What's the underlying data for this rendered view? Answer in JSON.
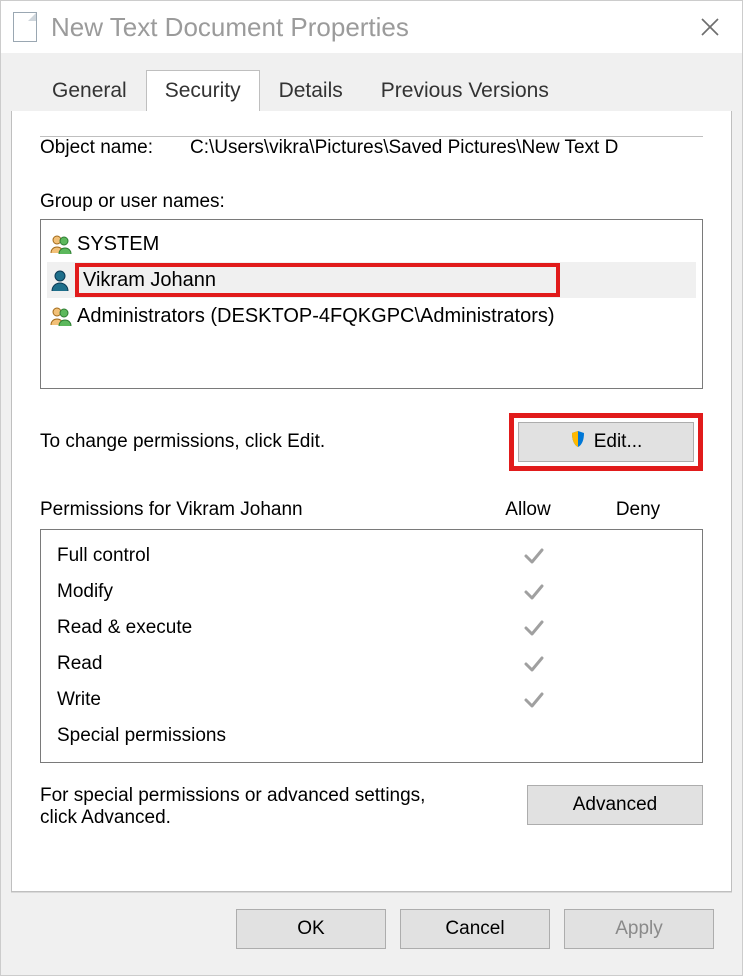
{
  "title": "New Text Document Properties",
  "tabs": [
    "General",
    "Security",
    "Details",
    "Previous Versions"
  ],
  "active_tab_index": 1,
  "object_name_label": "Object name:",
  "object_name_value": "C:\\Users\\vikra\\Pictures\\Saved Pictures\\New Text D",
  "group_label": "Group or user names:",
  "users": [
    {
      "name": "SYSTEM",
      "icon": "group"
    },
    {
      "name": "Vikram Johann",
      "icon": "user-selected"
    },
    {
      "name": "Administrators (DESKTOP-4FQKGPC\\Administrators)",
      "icon": "group"
    }
  ],
  "selected_user_index": 1,
  "change_perm_text": "To change permissions, click Edit.",
  "edit_label": "Edit...",
  "permissions_for_label": "Permissions for Vikram Johann",
  "allow_label": "Allow",
  "deny_label": "Deny",
  "permissions": [
    {
      "name": "Full control",
      "allow": true,
      "deny": false
    },
    {
      "name": "Modify",
      "allow": true,
      "deny": false
    },
    {
      "name": "Read & execute",
      "allow": true,
      "deny": false
    },
    {
      "name": "Read",
      "allow": true,
      "deny": false
    },
    {
      "name": "Write",
      "allow": true,
      "deny": false
    },
    {
      "name": "Special permissions",
      "allow": false,
      "deny": false
    }
  ],
  "advanced_text": "For special permissions or advanced settings, click Advanced.",
  "advanced_label": "Advanced",
  "ok_label": "OK",
  "cancel_label": "Cancel",
  "apply_label": "Apply"
}
